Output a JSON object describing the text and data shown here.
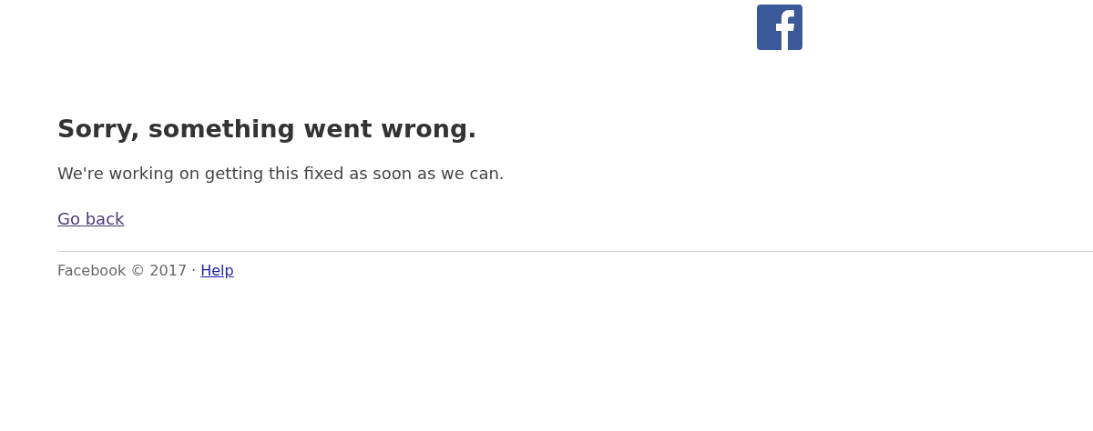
{
  "header": {
    "logo": {
      "kind": "facebook"
    }
  },
  "error": {
    "title": "Sorry, something went wrong.",
    "message": "We're working on getting this fixed as soon as we can.",
    "link": "Go back"
  },
  "footer": {
    "copyright": "Facebook © 2017",
    "separator": "·",
    "link": "Help"
  }
}
